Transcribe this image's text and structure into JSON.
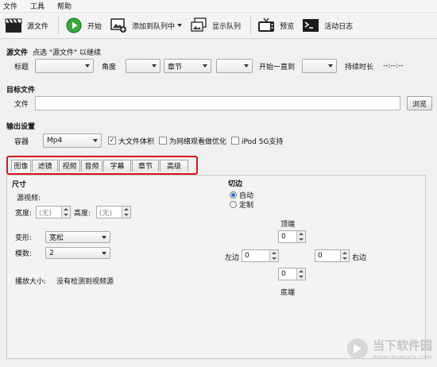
{
  "menu": [
    "文件",
    "工具",
    "帮助"
  ],
  "toolbar": {
    "source": "源文件",
    "start": "开始",
    "add_queue": "添加到队列中",
    "show_queue": "显示队列",
    "preview": "预览",
    "activity_log": "活动日志"
  },
  "source": {
    "heading": "源文件",
    "hint": "点选 \"源文件\" 以继续",
    "title_label": "标题",
    "angle_label": "角度",
    "chapter_value": "章节",
    "start_until": "开始一直到",
    "duration_label": "持续时长",
    "duration_value": "--:--:--"
  },
  "destination": {
    "heading": "目标文件",
    "file_label": "文件",
    "file_value": "",
    "browse": "浏览"
  },
  "output": {
    "heading": "输出设置",
    "container_label": "容器",
    "container_value": "Mp4",
    "large_file": "大文件体积",
    "web_optimize": "为网络观看做优化",
    "ipod": "iPod 5G支持"
  },
  "tabs": [
    "图像",
    "滤镜",
    "视频",
    "音频",
    "字幕",
    "章节",
    "高级"
  ],
  "picture": {
    "size_heading": "尺寸",
    "source_label": "源视频:",
    "width_label": "宽度:",
    "width_value": "(无)",
    "height_label": "高度:",
    "height_value": "(无)",
    "anamorphic_label": "变形:",
    "anamorphic_value": "宽松",
    "modulus_label": "模数:",
    "modulus_value": "2",
    "display_size_label": "播放大小:",
    "display_size_value": "没有检测到视频源"
  },
  "crop": {
    "heading": "切边",
    "auto": "自动",
    "custom": "定制",
    "top_label": "顶端",
    "top_value": "0",
    "left_label": "左边",
    "left_value": "0",
    "right_label": "右边",
    "right_value": "0",
    "bottom_label": "底端",
    "bottom_value": "0"
  },
  "watermark": {
    "brand": "当下软件园",
    "url": "www.downxia.com"
  }
}
